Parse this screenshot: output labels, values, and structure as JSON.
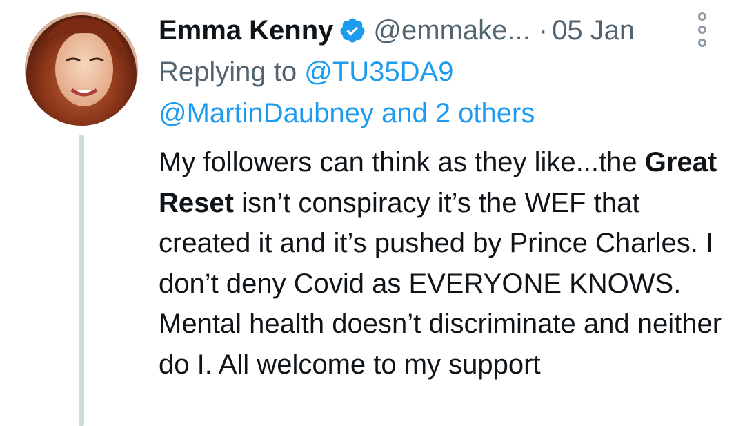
{
  "author": {
    "name": "Emma Kenny",
    "handle": "@emmake...",
    "separator": "·",
    "date": "05 Jan",
    "verified_icon": "verified-badge-icon",
    "avatar_icon": "profile-photo"
  },
  "reply": {
    "prefix": "Replying to ",
    "first_mention": "@TU35DA9",
    "second_mention": "@MartinDaubney",
    "others": " and 2 others"
  },
  "body": {
    "part1": "My followers can think as they like...the ",
    "bold": "Great Reset",
    "part2": " isn’t conspiracy it’s the WEF that created it and it’s pushed by Prince Charles. I don’t deny Covid as EVERYONE KNOWS. Mental health doesn’t discriminate and neither do I. All welcome to my support"
  },
  "colors": {
    "link": "#1d9bf0",
    "muted": "#536471",
    "verified": "#1d9bf0",
    "thread_line": "#cfd9de"
  },
  "more_icon": "more-vertical-icon"
}
